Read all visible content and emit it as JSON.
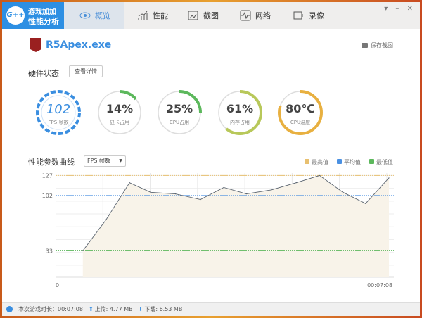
{
  "logo": {
    "badge": "G++",
    "line1": "游戏加加",
    "line2": "性能分析"
  },
  "tabs": [
    {
      "label": "概览"
    },
    {
      "label": "性能"
    },
    {
      "label": "截图"
    },
    {
      "label": "网络"
    },
    {
      "label": "录像"
    }
  ],
  "window_controls": "▾ – ✕",
  "app": {
    "name": "R5Apex.exe",
    "save_label": "保存截图"
  },
  "hardware": {
    "title": "硬件状态",
    "details_button": "查看详情",
    "gauges": [
      {
        "value": "102",
        "label": "FPS 帧数",
        "percent": 100,
        "color": "#3a8ee0"
      },
      {
        "value": "14%",
        "label": "显卡占用",
        "percent": 14,
        "color": "#5cb85c"
      },
      {
        "value": "25%",
        "label": "CPU占用",
        "percent": 25,
        "color": "#5cb85c"
      },
      {
        "value": "61%",
        "label": "内存占用",
        "percent": 61,
        "color": "#b8c85a"
      },
      {
        "value": "80℃",
        "label": "CPU温度",
        "percent": 80,
        "color": "#e8b040"
      }
    ]
  },
  "curve": {
    "title": "性能参数曲线",
    "select": "FPS 帧数"
  },
  "legend": [
    {
      "label": "最高值",
      "color": "#e8c070"
    },
    {
      "label": "平均值",
      "color": "#4a90e2"
    },
    {
      "label": "最低值",
      "color": "#5cb85c"
    }
  ],
  "chart_data": {
    "type": "area",
    "ylabel": "FPS",
    "ylim": [
      0,
      130
    ],
    "yticks": [
      {
        "label": "127",
        "value": 127,
        "color": "#e8c070"
      },
      {
        "label": "102",
        "value": 102,
        "color": "#4a90e2"
      },
      {
        "label": "33",
        "value": 33,
        "color": "#5cb85c"
      }
    ],
    "xlim_seconds": [
      0,
      428
    ],
    "xlabels": {
      "start": "0",
      "end": "00:07:08"
    },
    "x_seconds": [
      35,
      65,
      95,
      122,
      154,
      186,
      216,
      245,
      277,
      309,
      339,
      369,
      398,
      428
    ],
    "values": [
      33,
      72,
      118,
      106,
      104,
      97,
      112,
      104,
      109,
      118,
      127,
      106,
      92,
      124
    ]
  },
  "status": {
    "duration": "本次游戏时长：00:07:08",
    "upload": "上传: 4.77 MB",
    "download": "下载: 6.53 MB"
  }
}
